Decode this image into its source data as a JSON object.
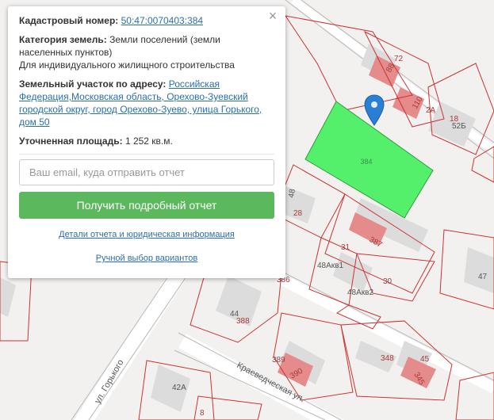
{
  "popup": {
    "close_glyph": "×",
    "cadastral": {
      "label": "Кадастровый номер:",
      "value": "50:47:0070403:384"
    },
    "category": {
      "label": "Категория земель:",
      "value": "Земли поселений (земли населенных пунктов)",
      "use": "Для индивидуального жилищного строительства"
    },
    "address": {
      "label": "Земельный участок по адресу:",
      "value": "Российская Федерация,Московская область, Орехово-Зуевский городской округ, город Орехово-Зуево, улица Горького, дом 50"
    },
    "area": {
      "label": "Уточненная площадь:",
      "value": "1 252 кв.м."
    },
    "email_placeholder": "Ваш email, куда отправить отчет",
    "report_button": "Получить подробный отчет",
    "details_link": "Детали отчета и юридическая информация",
    "manual_link": "Ручной выбор вариантов"
  },
  "map": {
    "colors": {
      "background": "#f3f1ef",
      "parcel_border": "#cc3333",
      "parcel_label": "#a83a3a",
      "building": "#dcdcdc",
      "building_pink": "#e58b8b",
      "selected_fill": "#55f06b",
      "selected_border": "#2e9e3c",
      "marker": "#2a7fd4",
      "street": "#ffffff"
    },
    "selected_label": "384",
    "parcel_labels": [
      "72",
      "88",
      "110",
      "2А",
      "18",
      "52Б",
      "48",
      "28",
      "387",
      "31",
      "48Акв1",
      "30",
      "48Акв2",
      "47",
      "386",
      "44",
      "388",
      "389",
      "390",
      "348",
      "45",
      "345",
      "42А",
      "8"
    ],
    "street_labels": [
      "ул. Горького",
      "Краеведческая ул."
    ]
  }
}
